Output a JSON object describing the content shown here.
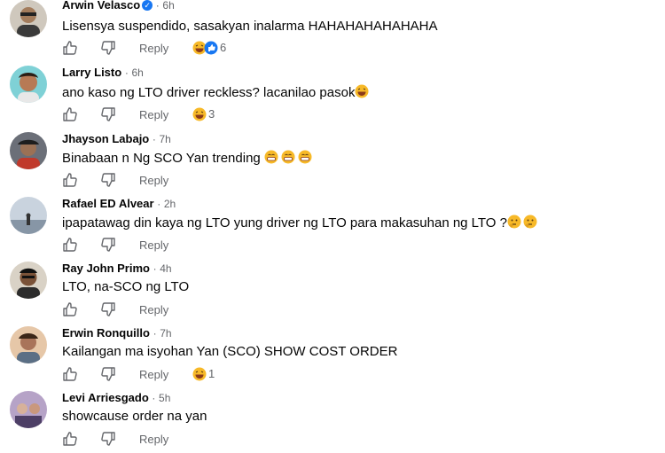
{
  "comments": [
    {
      "name": "Arwin Velasco",
      "time": "6h",
      "text": "Lisensya suspendido, sasakyan inalarma HAHAHAHAHAHAHA",
      "reply": "Reply",
      "reactions": "6",
      "reaction_icons": [
        "laugh-emoji",
        "like-icon"
      ],
      "verified": true
    },
    {
      "name": "Larry Listo",
      "time": "6h",
      "text": "ano kaso ng LTO driver reckless? lacanilao pasok",
      "reply": "Reply",
      "reactions": "3",
      "reaction_icons": [
        "laugh-emoji"
      ]
    },
    {
      "name": "Jhayson Labajo",
      "time": "7h",
      "text": "Binabaan n Ng SCO Yan trending",
      "reply": "Reply"
    },
    {
      "name": "Rafael ED Alvear",
      "time": "2h",
      "text": "ipapatawag din kaya ng LTO yung driver ng LTO para makasuhan ng LTO ?",
      "reply": "Reply"
    },
    {
      "name": "Ray John Primo",
      "time": "4h",
      "text": "LTO, na-SCO ng LTO",
      "reply": "Reply"
    },
    {
      "name": "Erwin Ronquillo",
      "time": "7h",
      "text": "Kailangan ma isyohan Yan (SCO) SHOW COST ORDER",
      "reply": "Reply",
      "reactions": "1",
      "reaction_icons": [
        "laugh-emoji"
      ]
    },
    {
      "name": "Levi Arriesgado",
      "time": "5h",
      "text": "showcause order na yan",
      "reply": "Reply"
    }
  ],
  "separator": "·"
}
